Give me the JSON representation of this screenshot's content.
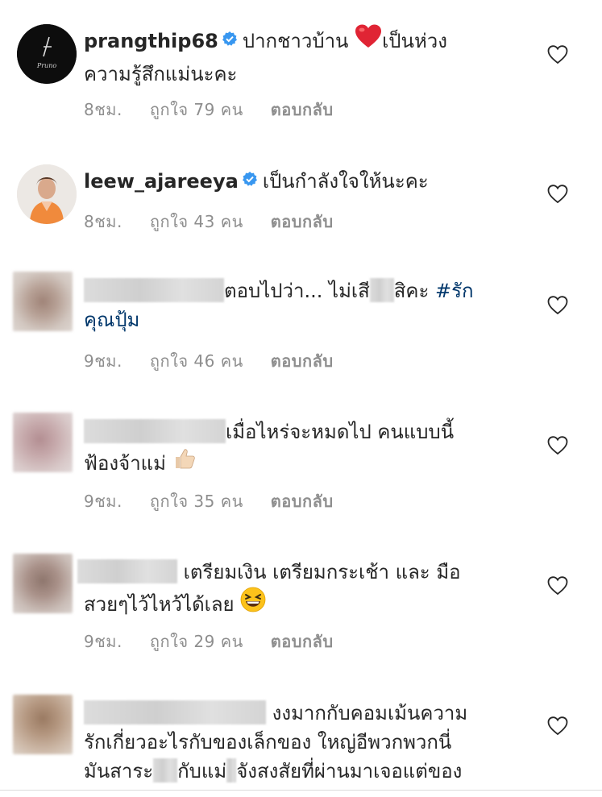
{
  "comments": [
    {
      "username": "prangthip68",
      "verified": true,
      "text_line1": "ปากชาวบ้าน",
      "text_line1_after_emoji": "เป็นห่วง",
      "text_line2": "ความรู้สึกแม่นะคะ",
      "time": "8ชม.",
      "likes": "ถูกใจ 79 คน",
      "reply": "ตอบกลับ",
      "emoji": "red-heart",
      "avatar_logo_text": "Pruno"
    },
    {
      "username": "leew_ajareeya",
      "verified": true,
      "text_line1": "เป็นกำลังใจให้นะคะ",
      "time": "8ชม.",
      "likes": "ถูกใจ 43 คน",
      "reply": "ตอบกลับ"
    },
    {
      "text_line1_a": "ตอบไปว่า... ไม่เสี",
      "text_line1_b": "สิคะ",
      "hashtag": "#รัก",
      "text_line2": "คุณปุ้ม",
      "time": "9ชม.",
      "likes": "ถูกใจ 46 คน",
      "reply": "ตอบกลับ"
    },
    {
      "text_line1": "เมื่อไหร่จะหมดไป คนแบบนี้",
      "text_line2": "ฟ้องจ้าแม่",
      "emoji": "thumbs-up",
      "time": "9ชม.",
      "likes": "ถูกใจ 35 คน",
      "reply": "ตอบกลับ"
    },
    {
      "text_line1": "เตรียมเงิน เตรียมกระเช้า และ มือ",
      "text_line2": "สวยๆไว้ไหว้ได้เลย",
      "emoji": "grinning-squinting-face",
      "time": "9ชม.",
      "likes": "ถูกใจ 29 คน",
      "reply": "ตอบกลับ"
    },
    {
      "text_line1": "งงมากกับคอมเม้นความ",
      "text_line2": "รักเกี่ยวอะไรกับของเล็กของ ใหญ่อีพวกพวกนี่",
      "text_line3_a": "มันสาระ",
      "text_line3_b": "กับแม่",
      "text_line3_c": "จังสงสัยที่ผ่านมาเจอแต่ของ"
    }
  ],
  "colors": {
    "text": "#262626",
    "meta": "#8e8e8e",
    "hashtag": "#00376b",
    "verified": "#3897f0"
  }
}
